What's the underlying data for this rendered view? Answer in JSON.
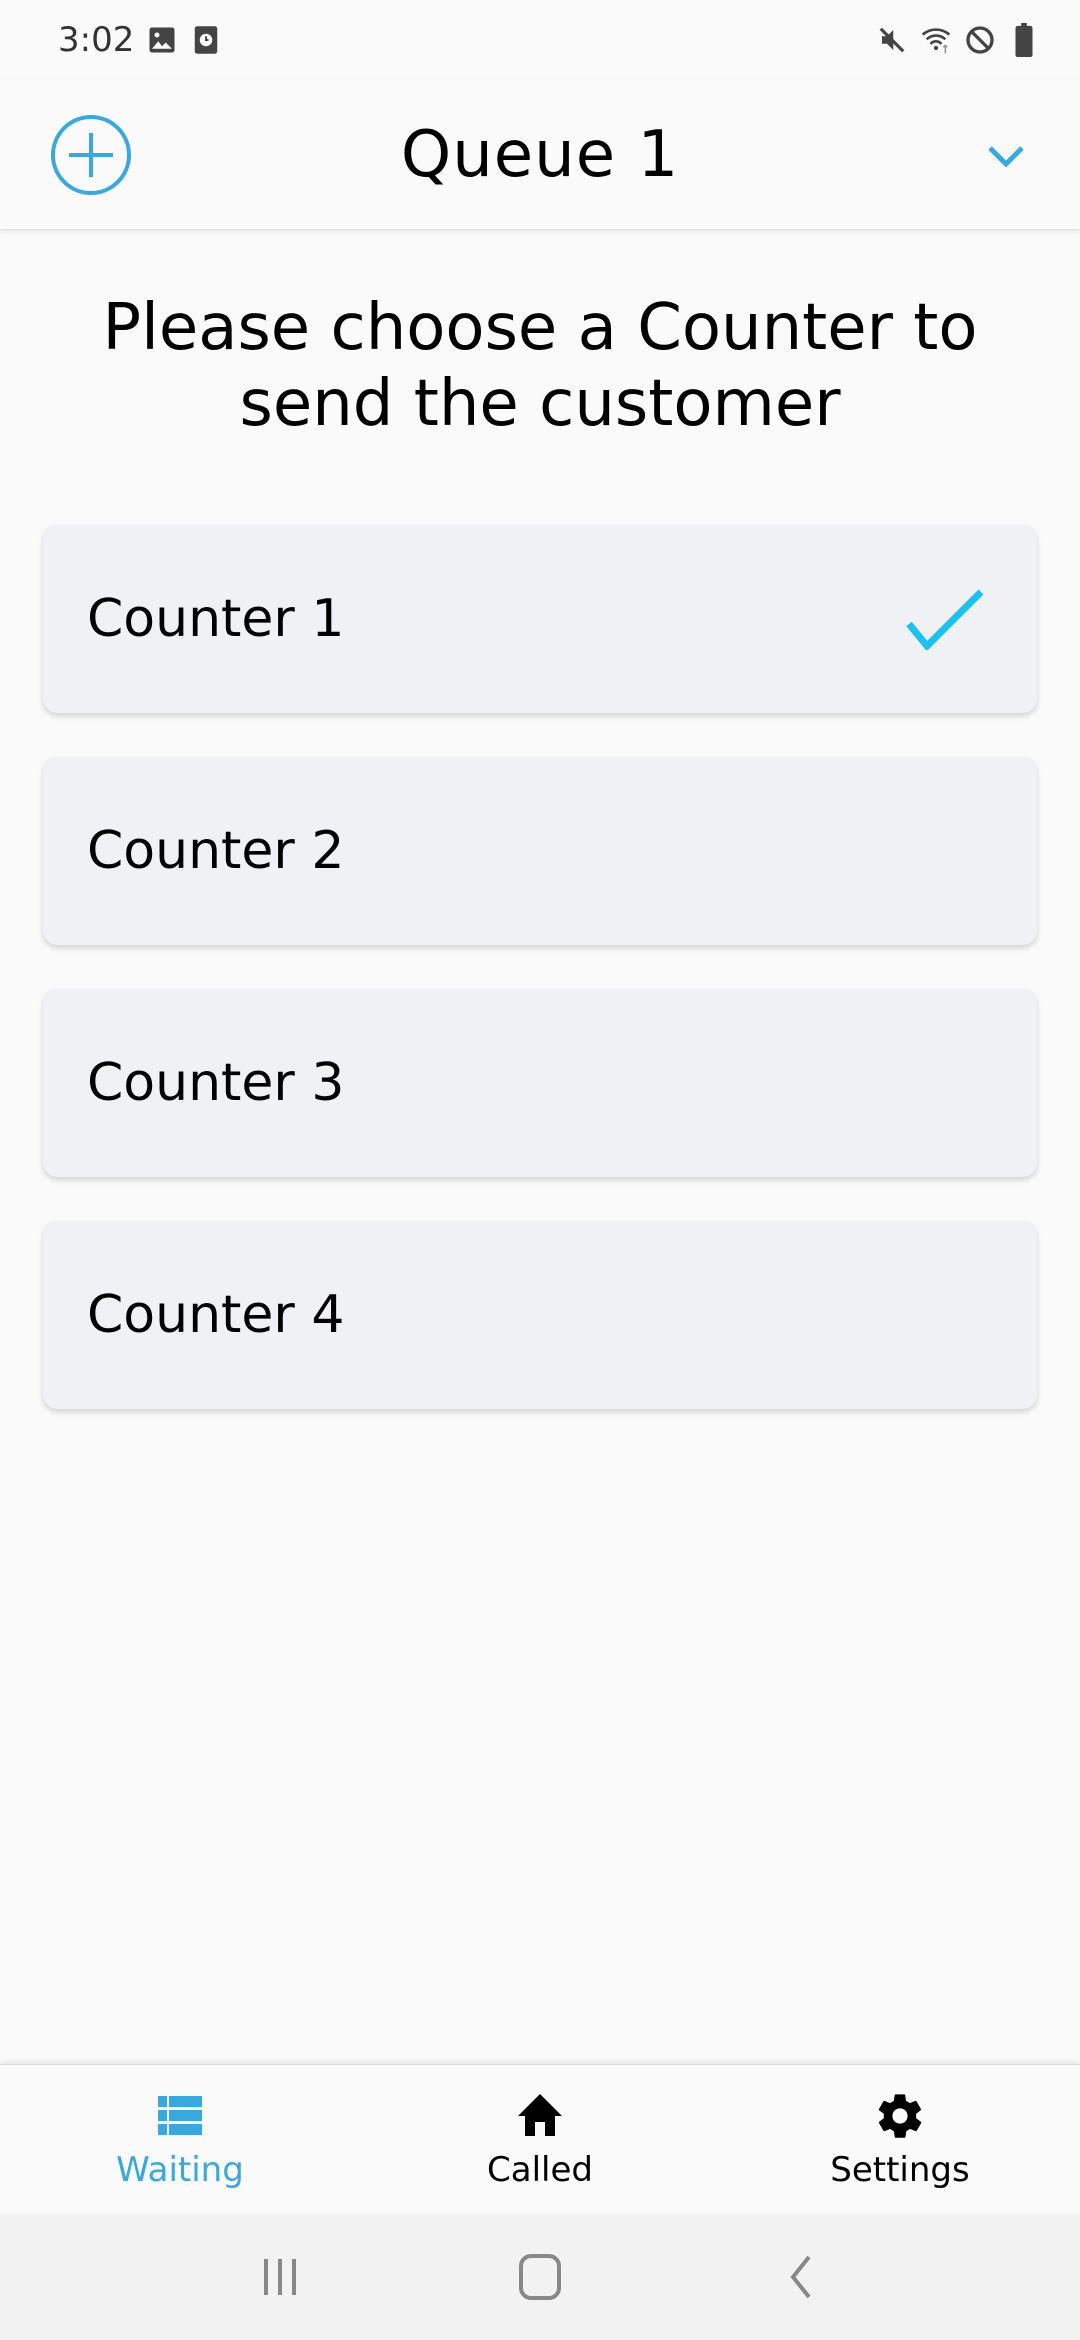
{
  "status_bar": {
    "time": "3:02",
    "left_icons": [
      "image-icon",
      "clock-app-icon"
    ],
    "right_icons": [
      "mute-icon",
      "wifi-icon",
      "do-not-disturb-icon",
      "battery-icon"
    ]
  },
  "app_bar": {
    "title": "Queue 1",
    "add_icon": "add-circle-icon",
    "dropdown_icon": "chevron-down-icon"
  },
  "prompt": "Please choose a Counter to send the customer",
  "counters": [
    {
      "label": "Counter 1",
      "selected": true
    },
    {
      "label": "Counter 2",
      "selected": false
    },
    {
      "label": "Counter 3",
      "selected": false
    },
    {
      "label": "Counter 4",
      "selected": false
    }
  ],
  "bottom_nav": {
    "items": [
      {
        "label": "Waiting",
        "icon": "list-icon",
        "active": true
      },
      {
        "label": "Called",
        "icon": "home-icon",
        "active": false
      },
      {
        "label": "Settings",
        "icon": "gear-icon",
        "active": false
      }
    ]
  },
  "colors": {
    "accent": "#3aa8dc",
    "check": "#1ec0ee",
    "card_bg": "#f0f1f4",
    "page_bg": "#fafafa"
  }
}
